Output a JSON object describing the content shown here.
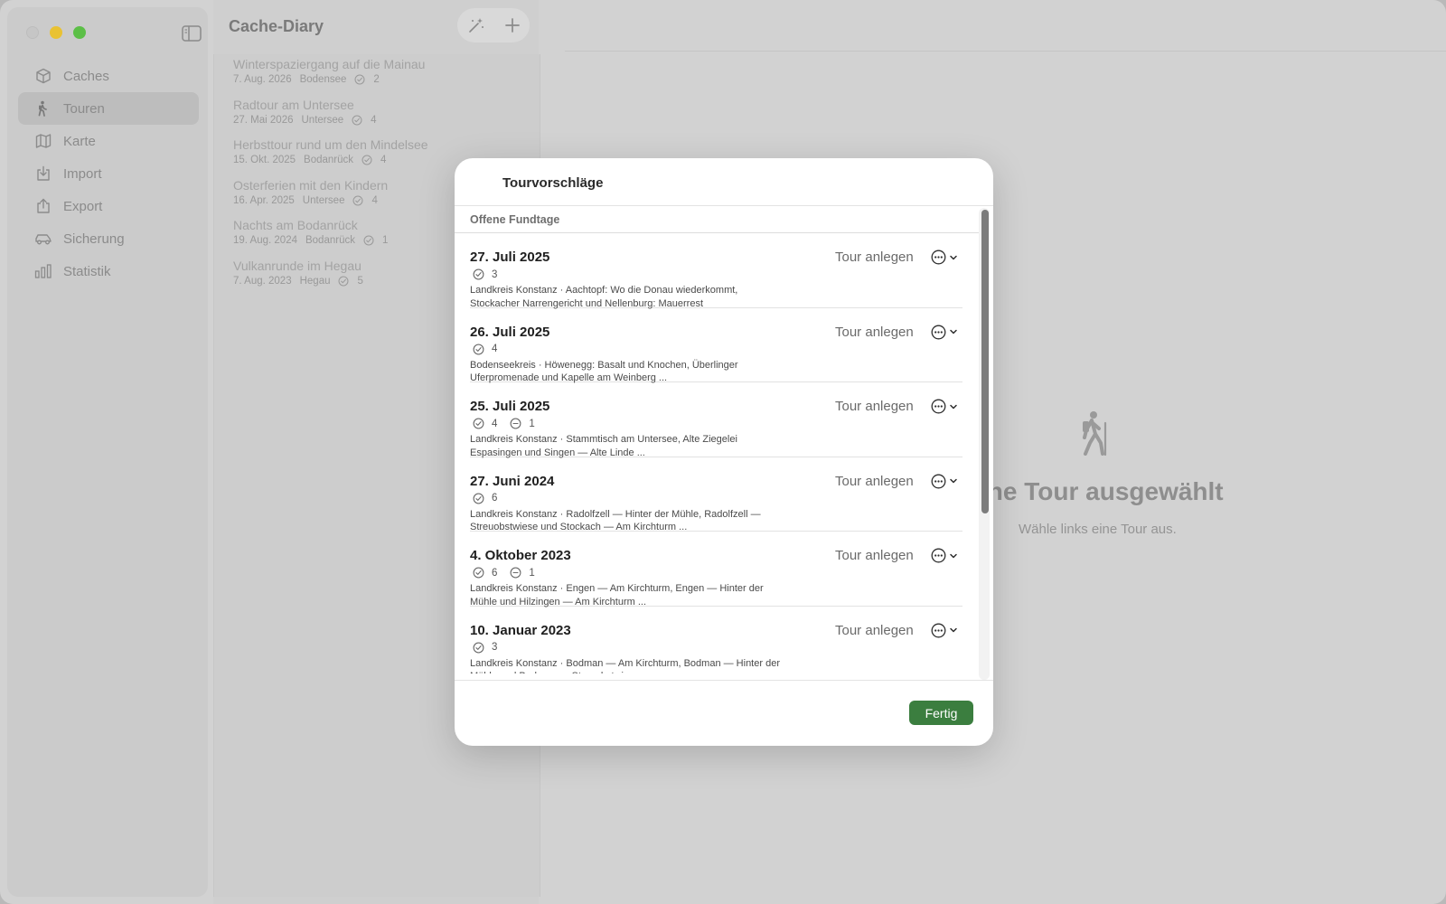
{
  "app": {
    "title": "Cache-Diary"
  },
  "sidebar": {
    "items": [
      {
        "label": "Caches",
        "icon": "cube-icon",
        "active": false
      },
      {
        "label": "Touren",
        "icon": "hiker-icon",
        "active": true
      },
      {
        "label": "Karte",
        "icon": "map-icon",
        "active": false
      },
      {
        "label": "Import",
        "icon": "import-icon",
        "active": false
      },
      {
        "label": "Export",
        "icon": "export-icon",
        "active": false
      },
      {
        "label": "Sicherung",
        "icon": "car-icon",
        "active": false
      },
      {
        "label": "Statistik",
        "icon": "chart-icon",
        "active": false
      }
    ]
  },
  "tours": [
    {
      "name": "Winterspaziergang auf die Mainau",
      "date": "7. Aug. 2026",
      "region": "Bodensee",
      "count": "2"
    },
    {
      "name": "Radtour am Untersee",
      "date": "27. Mai 2026",
      "region": "Untersee",
      "count": "4"
    },
    {
      "name": "Herbsttour rund um den Mindelsee",
      "date": "15. Okt. 2025",
      "region": "Bodanrück",
      "count": "4"
    },
    {
      "name": "Osterferien mit den Kindern",
      "date": "16. Apr. 2025",
      "region": "Untersee",
      "count": "4"
    },
    {
      "name": "Nachts am Bodanrück",
      "date": "19. Aug. 2024",
      "region": "Bodanrück",
      "count": "1"
    },
    {
      "name": "Vulkanrunde im Hegau",
      "date": "7. Aug. 2023",
      "region": "Hegau",
      "count": "5"
    }
  ],
  "detail": {
    "empty_title": "ine Tour ausgewählt",
    "empty_subtitle": "Wähle links eine Tour aus."
  },
  "modal": {
    "title": "Tourvorschläge",
    "section_header": "Offene Fundtage",
    "tour_button_label": "Tour anlegen",
    "done_label": "Fertig",
    "days": [
      {
        "date": "27. Juli 2025",
        "found": "3",
        "dnf": null,
        "line1": "Landkreis Konstanz · Aachtopf: Wo die Donau wiederkommt,",
        "line2": "Stockacher Narrengericht und Nellenburg: Mauerrest"
      },
      {
        "date": "26. Juli 2025",
        "found": "4",
        "dnf": null,
        "line1": "Bodenseekreis · Höwenegg: Basalt und Knochen, Überlinger",
        "line2": "Uferpromenade und Kapelle am Weinberg ..."
      },
      {
        "date": "25. Juli 2025",
        "found": "4",
        "dnf": "1",
        "line1": "Landkreis Konstanz · Stammtisch am Untersee, Alte Ziegelei",
        "line2": "Espasingen und Singen — Alte Linde ..."
      },
      {
        "date": "27. Juni 2024",
        "found": "6",
        "dnf": null,
        "line1": "Landkreis Konstanz · Radolfzell — Hinter der Mühle, Radolfzell —",
        "line2": "Streuobstwiese und Stockach — Am Kirchturm ..."
      },
      {
        "date": "4. Oktober 2023",
        "found": "6",
        "dnf": "1",
        "line1": "Landkreis Konstanz · Engen — Am Kirchturm, Engen — Hinter der",
        "line2": "Mühle und Hilzingen — Am Kirchturm ..."
      },
      {
        "date": "10. Januar 2023",
        "found": "3",
        "dnf": null,
        "line1": "Landkreis Konstanz · Bodman — Am Kirchturm, Bodman — Hinter der",
        "line2": "Mühle und Bodman — Streuobstwiese ..."
      }
    ]
  }
}
